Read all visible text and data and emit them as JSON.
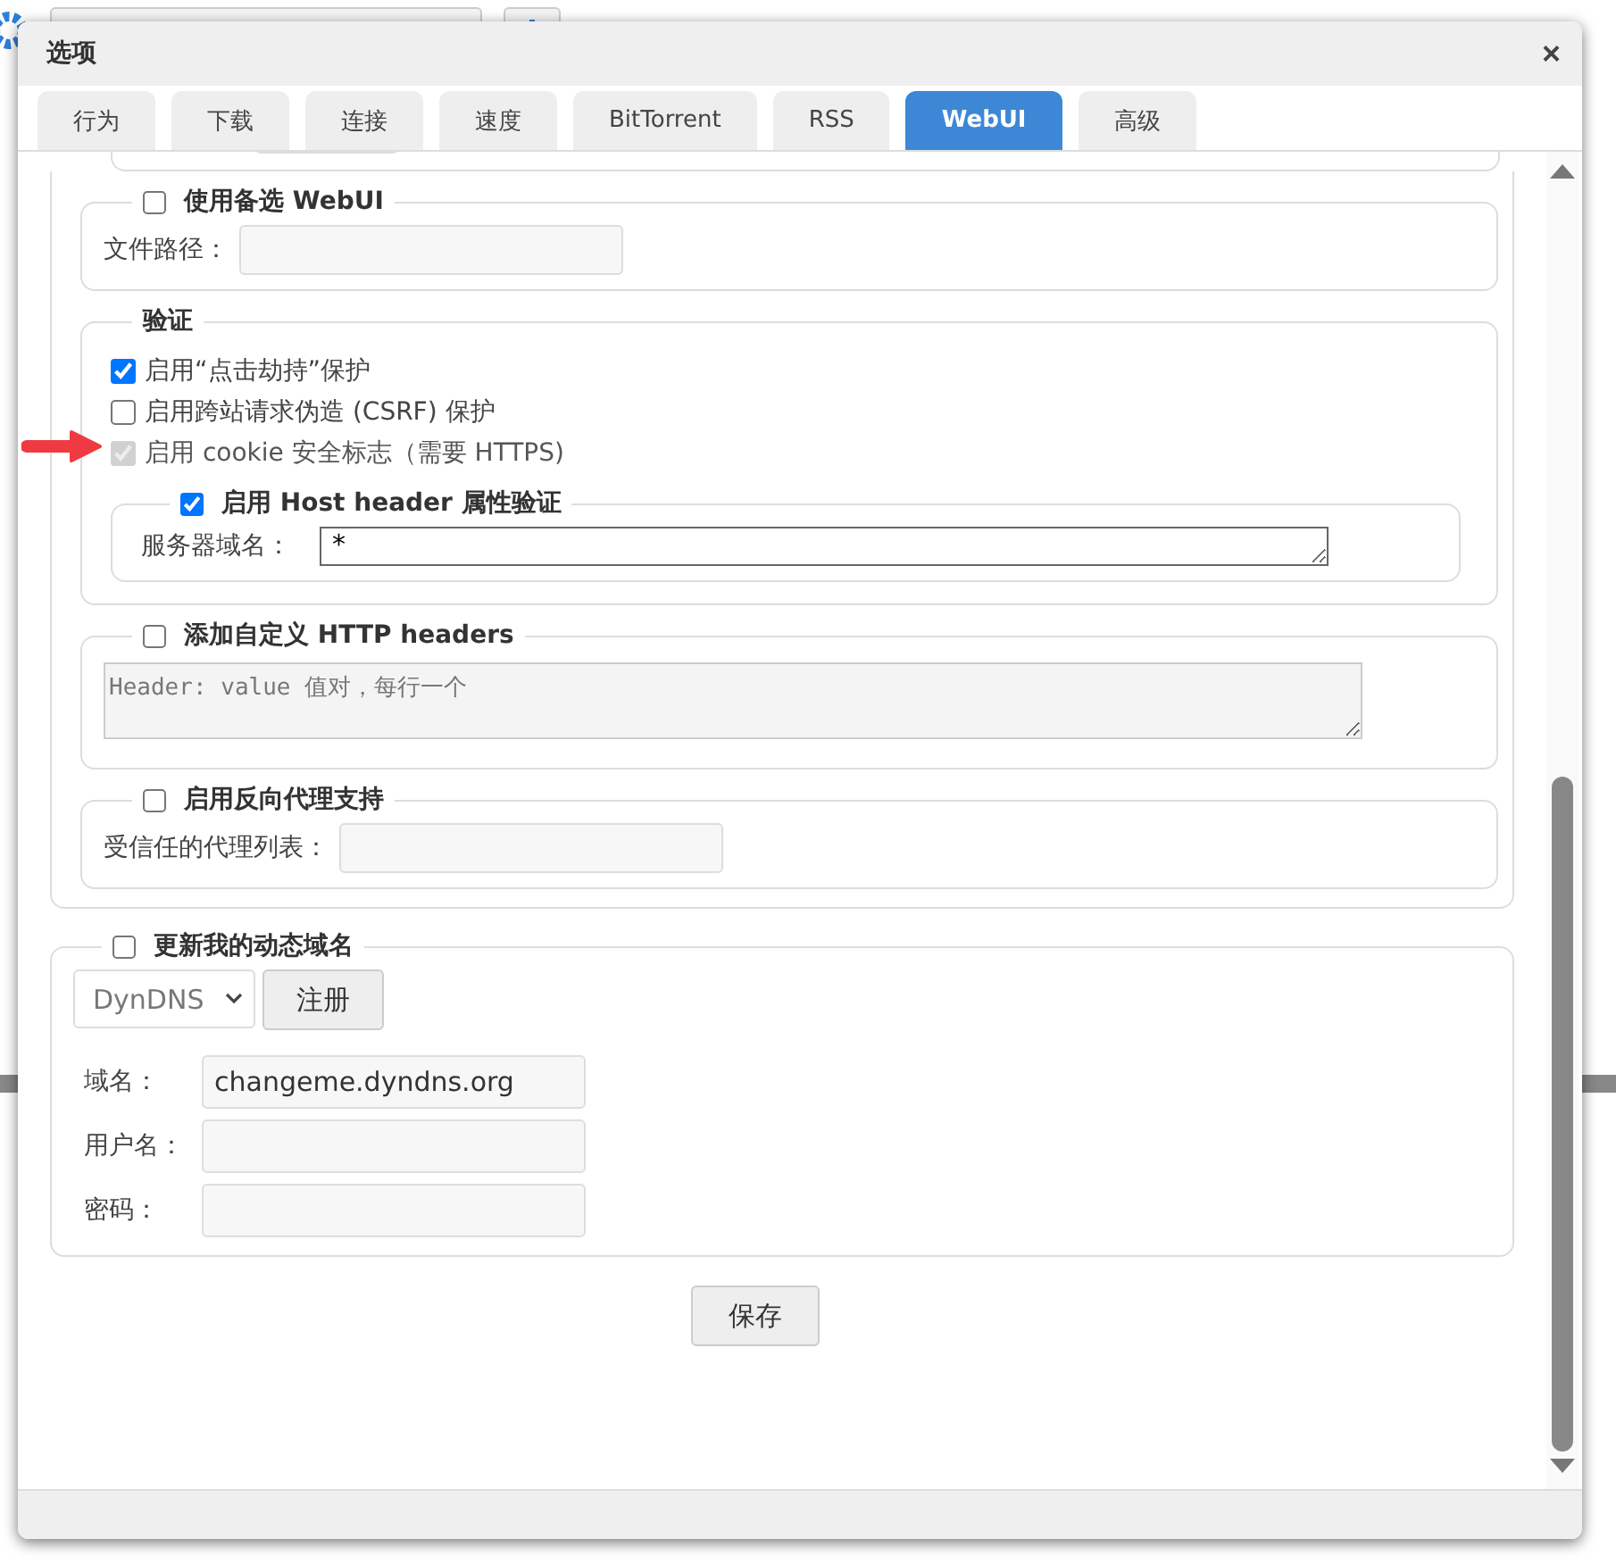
{
  "window": {
    "title": "选项",
    "close": "×"
  },
  "tabs": [
    {
      "label": "行为",
      "selected": false
    },
    {
      "label": "下载",
      "selected": false
    },
    {
      "label": "连接",
      "selected": false
    },
    {
      "label": "速度",
      "selected": false
    },
    {
      "label": "BitTorrent",
      "selected": false
    },
    {
      "label": "RSS",
      "selected": false
    },
    {
      "label": "WebUI",
      "selected": true
    },
    {
      "label": "高级",
      "selected": false
    }
  ],
  "alt_webui": {
    "label": "使用备选 WebUI",
    "checked": false,
    "field_label": "文件路径："
  },
  "auth": {
    "title": "验证",
    "options": [
      {
        "label": "启用“点击劫持”保护",
        "checked": true,
        "disabled": false
      },
      {
        "label": "启用跨站请求伪造 (CSRF) 保护",
        "checked": false,
        "disabled": false
      },
      {
        "label": "启用 cookie 安全标志（需要 HTTPS)",
        "checked": true,
        "disabled": true
      }
    ],
    "host_header": {
      "label": "启用 Host header 属性验证",
      "checked": true,
      "field_label": "服务器域名：",
      "value": "*"
    }
  },
  "custom_headers": {
    "label": "添加自定义 HTTP headers",
    "checked": false,
    "placeholder": "Header: value 值对，每行一个"
  },
  "reverse_proxy": {
    "label": "启用反向代理支持",
    "checked": false,
    "field_label": "受信任的代理列表："
  },
  "dyndns": {
    "label": "更新我的动态域名",
    "checked": false,
    "service": "DynDNS",
    "register": "注册",
    "fields": [
      {
        "label": "域名：",
        "value": "changeme.dyndns.org"
      },
      {
        "label": "用户名："
      },
      {
        "label": "密码："
      }
    ]
  },
  "save": "保存"
}
